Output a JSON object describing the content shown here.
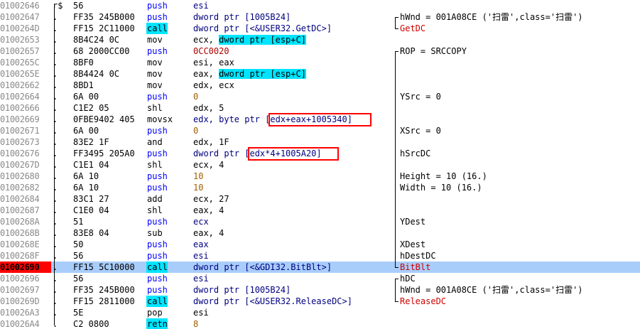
{
  "colors": {
    "selected_row": "#a9cdfa",
    "current_address_bg": "#ff0000",
    "call_highlight": "#00e5ff",
    "mnemonic_push": "#0000ff",
    "comment_red": "#d00000",
    "annotation_box": "#ff0000"
  },
  "rows": [
    {
      "addr": "01002646",
      "gutter": "r$",
      "hex": "56",
      "mnemonic": "push",
      "mtype": "push",
      "operand": "esi",
      "otype": "plain",
      "comment": "",
      "ctype": ""
    },
    {
      "addr": "01002647",
      "gutter": ".",
      "hex": "FF35 245B000",
      "mnemonic": "push",
      "mtype": "push",
      "operand": "dword ptr [1005B24]",
      "otype": "plain",
      "comment": "hWnd = 001A08CE ('扫雷',class='扫雷')",
      "ctype": ""
    },
    {
      "addr": "0100264D",
      "gutter": ".",
      "hex": "FF15 2C11000",
      "mnemonic": "call",
      "mtype": "call",
      "operand": "dword ptr [<&USER32.GetDC>]",
      "otype": "plain",
      "comment": "GetDC",
      "ctype": "red"
    },
    {
      "addr": "01002653",
      "gutter": ".",
      "hex": "8B4C24 0C",
      "mnemonic": "mov",
      "mtype": "plain",
      "operand": "ecx, dword ptr [esp+C]",
      "otype": "mem",
      "comment": "",
      "ctype": ""
    },
    {
      "addr": "01002657",
      "gutter": ".",
      "hex": "68 2000CC00",
      "mnemonic": "push",
      "mtype": "push",
      "operand": "0CC0020",
      "otype": "red",
      "comment": "ROP = SRCCOPY",
      "ctype": ""
    },
    {
      "addr": "0100265C",
      "gutter": ".",
      "hex": "8BF0",
      "mnemonic": "mov",
      "mtype": "plain",
      "operand": "esi, eax",
      "otype": "plain",
      "comment": "",
      "ctype": ""
    },
    {
      "addr": "0100265E",
      "gutter": ".",
      "hex": "8B4424 0C",
      "mnemonic": "mov",
      "mtype": "plain",
      "operand": "eax, dword ptr [esp+C]",
      "otype": "mem",
      "comment": "",
      "ctype": ""
    },
    {
      "addr": "01002662",
      "gutter": ".",
      "hex": "8BD1",
      "mnemonic": "mov",
      "mtype": "plain",
      "operand": "edx, ecx",
      "otype": "plain",
      "comment": "",
      "ctype": ""
    },
    {
      "addr": "01002664",
      "gutter": ".",
      "hex": "6A 00",
      "mnemonic": "push",
      "mtype": "push",
      "operand": "0",
      "otype": "num",
      "comment": "YSrc = 0",
      "ctype": ""
    },
    {
      "addr": "01002666",
      "gutter": ".",
      "hex": "C1E2 05",
      "mnemonic": "shl",
      "mtype": "plain",
      "operand": "edx, 5",
      "otype": "plain",
      "comment": "",
      "ctype": ""
    },
    {
      "addr": "01002669",
      "gutter": ".",
      "hex": "0FBE9402 405",
      "mnemonic": "movsx",
      "mtype": "plain",
      "operand": "edx, byte ptr [edx+eax+1005340]",
      "otype": "plain",
      "comment": "",
      "ctype": ""
    },
    {
      "addr": "01002671",
      "gutter": ".",
      "hex": "6A 00",
      "mnemonic": "push",
      "mtype": "push",
      "operand": "0",
      "otype": "num",
      "comment": "XSrc = 0",
      "ctype": ""
    },
    {
      "addr": "01002673",
      "gutter": ".",
      "hex": "83E2 1F",
      "mnemonic": "and",
      "mtype": "plain",
      "operand": "edx, 1F",
      "otype": "plain",
      "comment": "",
      "ctype": ""
    },
    {
      "addr": "01002676",
      "gutter": ".",
      "hex": "FF3495 205A0",
      "mnemonic": "push",
      "mtype": "push",
      "operand": "dword ptr [edx*4+1005A20]",
      "otype": "plain",
      "comment": "hSrcDC",
      "ctype": ""
    },
    {
      "addr": "0100267D",
      "gutter": ".",
      "hex": "C1E1 04",
      "mnemonic": "shl",
      "mtype": "plain",
      "operand": "ecx, 4",
      "otype": "plain",
      "comment": "",
      "ctype": ""
    },
    {
      "addr": "01002680",
      "gutter": ".",
      "hex": "6A 10",
      "mnemonic": "push",
      "mtype": "push",
      "operand": "10",
      "otype": "num",
      "comment": "Height = 10 (16.)",
      "ctype": ""
    },
    {
      "addr": "01002682",
      "gutter": ".",
      "hex": "6A 10",
      "mnemonic": "push",
      "mtype": "push",
      "operand": "10",
      "otype": "num",
      "comment": "Width = 10 (16.)",
      "ctype": ""
    },
    {
      "addr": "01002684",
      "gutter": ".",
      "hex": "83C1 27",
      "mnemonic": "add",
      "mtype": "plain",
      "operand": "ecx, 27",
      "otype": "plain",
      "comment": "",
      "ctype": ""
    },
    {
      "addr": "01002687",
      "gutter": ".",
      "hex": "C1E0 04",
      "mnemonic": "shl",
      "mtype": "plain",
      "operand": "eax, 4",
      "otype": "plain",
      "comment": "",
      "ctype": ""
    },
    {
      "addr": "0100268A",
      "gutter": ".",
      "hex": "51",
      "mnemonic": "push",
      "mtype": "push",
      "operand": "ecx",
      "otype": "plain",
      "comment": "YDest",
      "ctype": ""
    },
    {
      "addr": "0100268B",
      "gutter": ".",
      "hex": "83E8 04",
      "mnemonic": "sub",
      "mtype": "plain",
      "operand": "eax, 4",
      "otype": "plain",
      "comment": "",
      "ctype": ""
    },
    {
      "addr": "0100268E",
      "gutter": ".",
      "hex": "50",
      "mnemonic": "push",
      "mtype": "push",
      "operand": "eax",
      "otype": "plain",
      "comment": "XDest",
      "ctype": ""
    },
    {
      "addr": "0100268F",
      "gutter": ".",
      "hex": "56",
      "mnemonic": "push",
      "mtype": "push",
      "operand": "esi",
      "otype": "plain",
      "comment": "hDestDC",
      "ctype": ""
    },
    {
      "addr": "01002690",
      "gutter": ".",
      "hex": "FF15 5C10000",
      "mnemonic": "call",
      "mtype": "call",
      "operand": "dword ptr [<&GDI32.BitBlt>]",
      "otype": "plain",
      "comment": "BitBlt",
      "ctype": "red",
      "selected": true,
      "current": true
    },
    {
      "addr": "01002696",
      "gutter": ".",
      "hex": "56",
      "mnemonic": "push",
      "mtype": "push",
      "operand": "esi",
      "otype": "plain",
      "comment": "hDC",
      "ctype": ""
    },
    {
      "addr": "01002697",
      "gutter": ".",
      "hex": "FF35 245B000",
      "mnemonic": "push",
      "mtype": "push",
      "operand": "dword ptr [1005B24]",
      "otype": "plain",
      "comment": "hWnd = 001A08CE ('扫雷',class='扫雷')",
      "ctype": ""
    },
    {
      "addr": "0100269D",
      "gutter": ".",
      "hex": "FF15 2811000",
      "mnemonic": "call",
      "mtype": "call",
      "operand": "dword ptr [<&USER32.ReleaseDC>]",
      "otype": "plain",
      "comment": "ReleaseDC",
      "ctype": "red"
    },
    {
      "addr": "010026A3",
      "gutter": ".",
      "hex": "5E",
      "mnemonic": "pop",
      "mtype": "plain",
      "operand": "esi",
      "otype": "plain",
      "comment": "",
      "ctype": ""
    },
    {
      "addr": "010026A4",
      "gutter": ".",
      "hex": "C2 0800",
      "mnemonic": "retn",
      "mtype": "retn",
      "operand": "8",
      "otype": "num",
      "comment": "",
      "ctype": ""
    }
  ]
}
